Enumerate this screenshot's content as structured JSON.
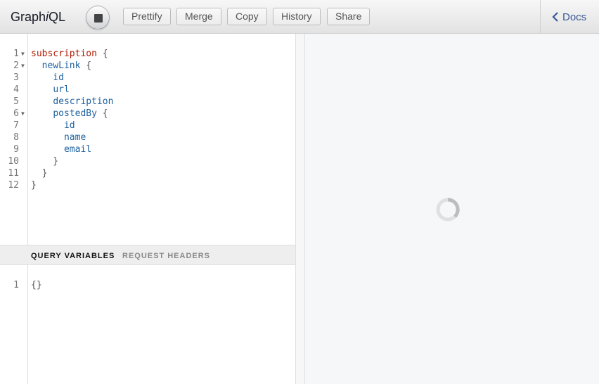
{
  "app": {
    "title_prefix": "Graph",
    "title_italic": "i",
    "title_suffix": "QL"
  },
  "toolbar": {
    "execute_state": "stop",
    "buttons": [
      "Prettify",
      "Merge",
      "Copy",
      "History",
      "Share"
    ]
  },
  "docs": {
    "label": "Docs"
  },
  "query_lines": [
    {
      "n": "1",
      "fold": true,
      "parts": [
        [
          "kw",
          "subscription"
        ],
        [
          "p",
          " {"
        ]
      ]
    },
    {
      "n": "2",
      "fold": true,
      "parts": [
        [
          "p",
          "  "
        ],
        [
          "fld",
          "newLink"
        ],
        [
          "p",
          " {"
        ]
      ]
    },
    {
      "n": "3",
      "fold": false,
      "parts": [
        [
          "p",
          "    "
        ],
        [
          "fld",
          "id"
        ]
      ]
    },
    {
      "n": "4",
      "fold": false,
      "parts": [
        [
          "p",
          "    "
        ],
        [
          "fld",
          "url"
        ]
      ]
    },
    {
      "n": "5",
      "fold": false,
      "parts": [
        [
          "p",
          "    "
        ],
        [
          "fld",
          "description"
        ]
      ]
    },
    {
      "n": "6",
      "fold": true,
      "parts": [
        [
          "p",
          "    "
        ],
        [
          "fld",
          "postedBy"
        ],
        [
          "p",
          " {"
        ]
      ]
    },
    {
      "n": "7",
      "fold": false,
      "parts": [
        [
          "p",
          "      "
        ],
        [
          "fld",
          "id"
        ]
      ]
    },
    {
      "n": "8",
      "fold": false,
      "parts": [
        [
          "p",
          "      "
        ],
        [
          "fld",
          "name"
        ]
      ]
    },
    {
      "n": "9",
      "fold": false,
      "parts": [
        [
          "p",
          "      "
        ],
        [
          "fld",
          "email"
        ]
      ]
    },
    {
      "n": "10",
      "fold": false,
      "parts": [
        [
          "p",
          "    }"
        ]
      ]
    },
    {
      "n": "11",
      "fold": false,
      "parts": [
        [
          "p",
          "  }"
        ]
      ]
    },
    {
      "n": "12",
      "fold": false,
      "parts": [
        [
          "p",
          "}"
        ]
      ]
    }
  ],
  "vars_tabs": {
    "active": "QUERY VARIABLES",
    "inactive": "REQUEST HEADERS"
  },
  "vars_lines": [
    {
      "n": "1",
      "text": "{}"
    }
  ],
  "colors": {
    "keyword": "#b11a04",
    "field": "#1f61a0",
    "docs_link": "#3b5998"
  },
  "icons": {
    "execute": "stop-icon",
    "docs": "chevron-left-icon",
    "result": "loading-spinner-icon"
  }
}
